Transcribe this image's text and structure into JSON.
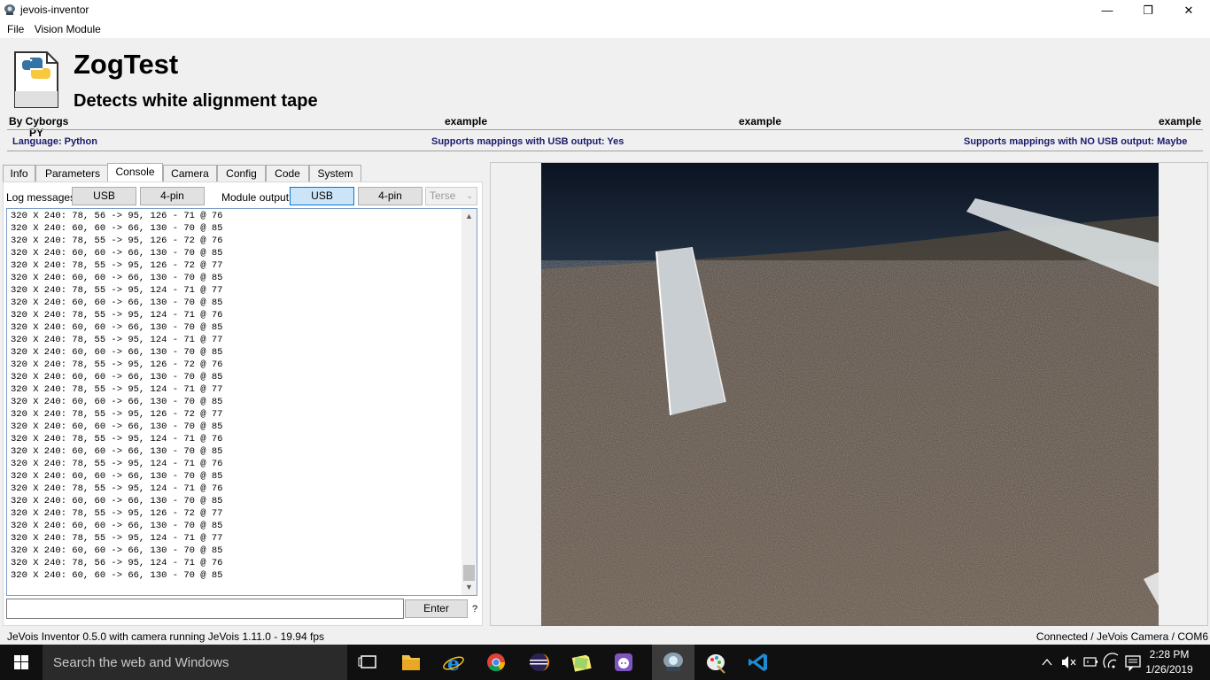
{
  "window": {
    "title": "jevois-inventor",
    "controls": [
      "minimize",
      "maximize",
      "close"
    ],
    "minimize_glyph": "—",
    "maximize_glyph": "❐",
    "close_glyph": "✕"
  },
  "menu": [
    "File",
    "Vision Module"
  ],
  "module": {
    "icon_text": "PY",
    "name": "ZogTest",
    "description": "Detects white alignment tape",
    "author": "By Cyborgs",
    "examples": [
      "example",
      "example",
      "example"
    ],
    "language": "Language: Python",
    "usb_support": "Supports mappings with USB output: Yes",
    "no_usb_support": "Supports mappings with NO USB output: Maybe"
  },
  "tabs": [
    "Info",
    "Parameters",
    "Console",
    "Camera",
    "Config",
    "Code",
    "System"
  ],
  "active_tab": "Console",
  "console": {
    "log_label": "Log messages:",
    "log_usb": "USB",
    "log_4pin": "4-pin",
    "module_output_label": "Module output:",
    "out_usb": "USB",
    "out_4pin": "4-pin",
    "verbosity": "Terse",
    "lines": [
      "320 X 240: 78, 56 -> 95, 126 - 71 @ 76",
      "320 X 240: 60, 60 -> 66, 130 - 70 @ 85",
      "320 X 240: 78, 55 -> 95, 126 - 72 @ 76",
      "320 X 240: 60, 60 -> 66, 130 - 70 @ 85",
      "320 X 240: 78, 55 -> 95, 126 - 72 @ 77",
      "320 X 240: 60, 60 -> 66, 130 - 70 @ 85",
      "320 X 240: 78, 55 -> 95, 124 - 71 @ 77",
      "320 X 240: 60, 60 -> 66, 130 - 70 @ 85",
      "320 X 240: 78, 55 -> 95, 124 - 71 @ 76",
      "320 X 240: 60, 60 -> 66, 130 - 70 @ 85",
      "320 X 240: 78, 55 -> 95, 124 - 71 @ 77",
      "320 X 240: 60, 60 -> 66, 130 - 70 @ 85",
      "320 X 240: 78, 55 -> 95, 126 - 72 @ 76",
      "320 X 240: 60, 60 -> 66, 130 - 70 @ 85",
      "320 X 240: 78, 55 -> 95, 124 - 71 @ 77",
      "320 X 240: 60, 60 -> 66, 130 - 70 @ 85",
      "320 X 240: 78, 55 -> 95, 126 - 72 @ 77",
      "320 X 240: 60, 60 -> 66, 130 - 70 @ 85",
      "320 X 240: 78, 55 -> 95, 124 - 71 @ 76",
      "320 X 240: 60, 60 -> 66, 130 - 70 @ 85",
      "320 X 240: 78, 55 -> 95, 124 - 71 @ 76",
      "320 X 240: 60, 60 -> 66, 130 - 70 @ 85",
      "320 X 240: 78, 55 -> 95, 124 - 71 @ 76",
      "320 X 240: 60, 60 -> 66, 130 - 70 @ 85",
      "320 X 240: 78, 55 -> 95, 126 - 72 @ 77",
      "320 X 240: 60, 60 -> 66, 130 - 70 @ 85",
      "320 X 240: 78, 55 -> 95, 124 - 71 @ 77",
      "320 X 240: 60, 60 -> 66, 130 - 70 @ 85",
      "320 X 240: 78, 56 -> 95, 124 - 71 @ 76",
      "320 X 240: 60, 60 -> 66, 130 - 70 @ 85"
    ],
    "scroll_up_glyph": "▲",
    "scroll_down_glyph": "▼",
    "command_value": "",
    "enter_label": "Enter",
    "help_label": "?"
  },
  "status": {
    "left": "JeVois Inventor 0.5.0 with camera running JeVois 1.11.0 - 19.94 fps",
    "right": "Connected / JeVois Camera / COM6"
  },
  "taskbar": {
    "search_placeholder": "Search the web and Windows",
    "apps": [
      "task-view",
      "file-explorer",
      "internet-explorer",
      "chrome",
      "eclipse",
      "sticky-notes",
      "github-desktop",
      "jevois-inventor",
      "paint",
      "visual-studio-code"
    ],
    "time": "2:28 PM",
    "date": "1/26/2019"
  },
  "colors": {
    "accent": "#0078d7",
    "selected_button": "#cce4f7",
    "info_text": "#1a1a6e",
    "taskbar": "#101010"
  }
}
